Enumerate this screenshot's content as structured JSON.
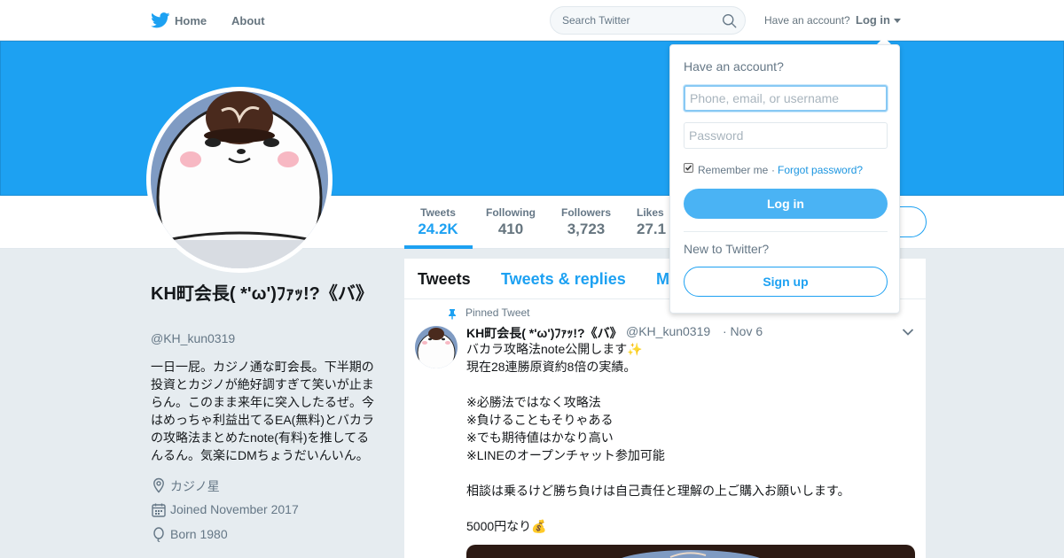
{
  "nav": {
    "home": "Home",
    "about": "About",
    "search_placeholder": "Search Twitter",
    "have_account": "Have an account?",
    "login": "Log in"
  },
  "profile": {
    "name": "KH町会長( *'ω')ﾌｧｯ!?《バ》",
    "handle": "@KH_kun0319",
    "bio": "一日一屁。カジノ通な町会長。下半期の投資とカジノが絶好調すぎて笑いが止まらん。このまま来年に突入したるぜ。今はめっちゃ利益出てるEA(無料)とバカラの攻略法まとめたnote(有料)を推してるんるん。気楽にDMちょうだいんいん。",
    "location": "カジノ星",
    "joined": "Joined November 2017",
    "born": "Born 1980"
  },
  "stats": [
    {
      "label": "Tweets",
      "value": "24.2K",
      "active": true
    },
    {
      "label": "Following",
      "value": "410"
    },
    {
      "label": "Followers",
      "value": "3,723"
    },
    {
      "label": "Likes",
      "value": "27.1"
    }
  ],
  "timeline": {
    "tabs": [
      "Tweets",
      "Tweets & replies",
      "M"
    ],
    "pinned_label": "Pinned Tweet",
    "tweet": {
      "name": "KH町会長( *'ω')ﾌｧｯ!?《バ》",
      "handle": "@KH_kun0319",
      "time": "· Nov 6",
      "text": "バカラ攻略法note公開します✨\n現在28連勝原資約8倍の実績。\n\n※必勝法ではなく攻略法\n※負けることもそりゃある\n※でも期待値はかなり高い\n※LINEのオープンチャット参加可能\n\n相談は乗るけど勝ち負けは自己責任と理解の上ご購入お願いします。\n\n5000円なり💰"
    }
  },
  "login_dropdown": {
    "title": "Have an account?",
    "username_placeholder": "Phone, email, or username",
    "password_placeholder": "Password",
    "remember": "Remember me",
    "separator": "·",
    "forgot": "Forgot password?",
    "login_button": "Log in",
    "new_to_twitter": "New to Twitter?",
    "signup_button": "Sign up"
  },
  "colors": {
    "brand_blue": "#1da1f2",
    "login_button": "#4ab3f4",
    "link": "#1b95e0"
  }
}
